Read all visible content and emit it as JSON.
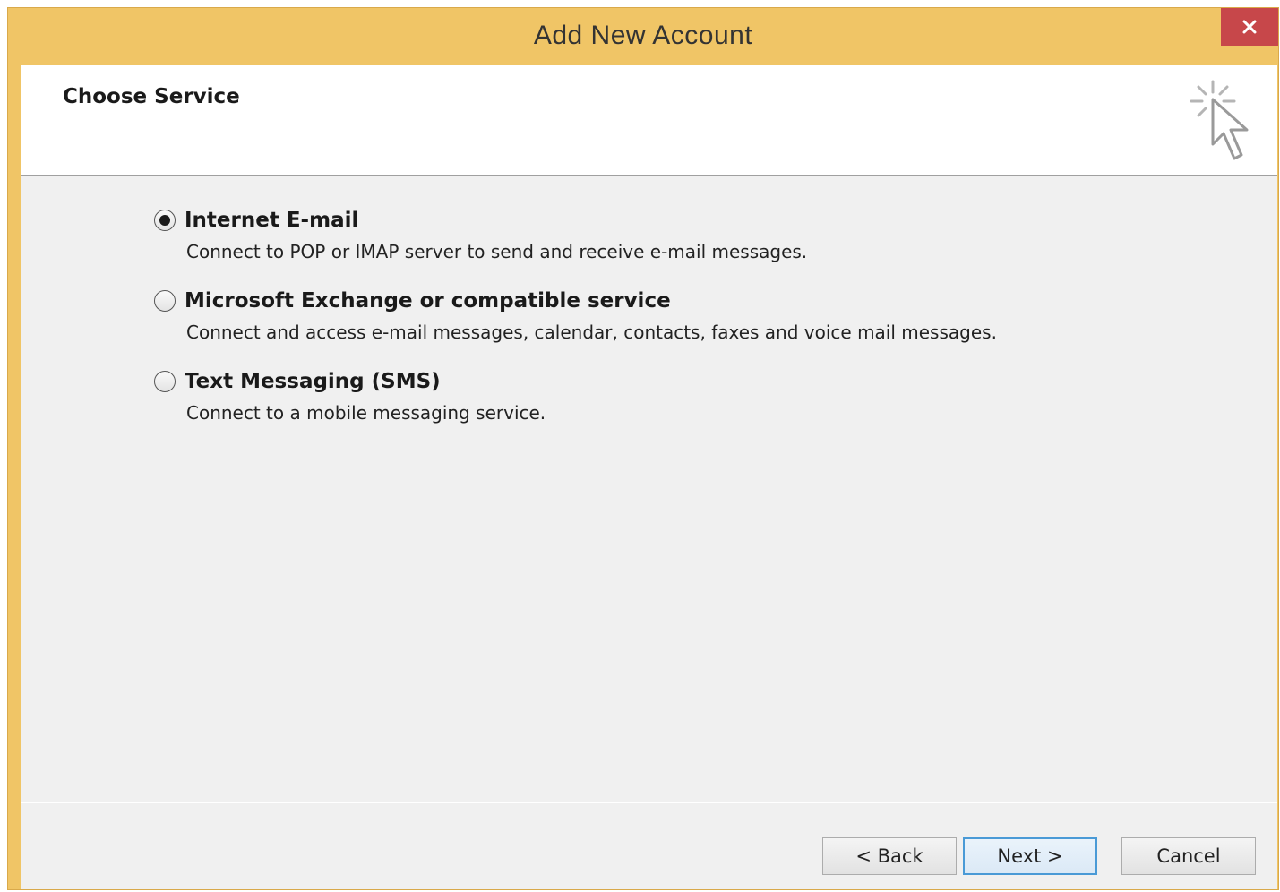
{
  "window": {
    "title": "Add New Account",
    "accent_color": "#f0c566",
    "close_color": "#c7474a"
  },
  "header": {
    "title": "Choose Service",
    "icon": "wizard-cursor-icon"
  },
  "options": [
    {
      "label": "Internet E-mail",
      "description": "Connect to POP or IMAP server to send and receive e-mail messages.",
      "selected": true
    },
    {
      "label": "Microsoft Exchange or compatible service",
      "description": "Connect and access e-mail messages, calendar, contacts, faxes and voice mail messages.",
      "selected": false
    },
    {
      "label": "Text Messaging (SMS)",
      "description": "Connect to a mobile messaging service.",
      "selected": false
    }
  ],
  "buttons": {
    "back": "< Back",
    "next": "Next >",
    "cancel": "Cancel"
  }
}
